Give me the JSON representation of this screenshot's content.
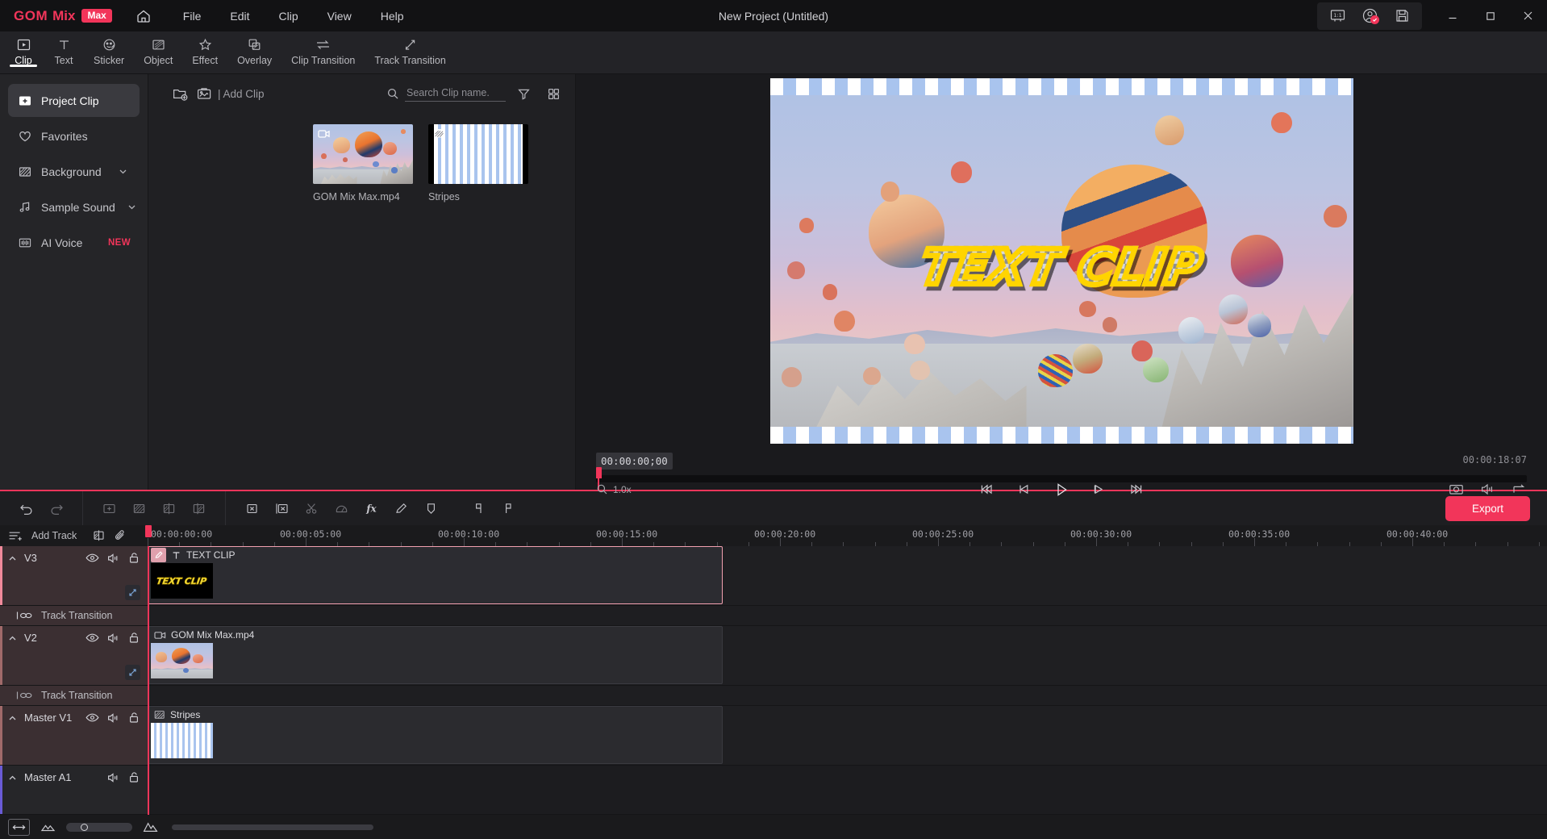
{
  "titlebar": {
    "brand_gom": "GOM",
    "brand_mix": "Mix",
    "brand_max": "Max",
    "home_icon": "home-icon",
    "menus": [
      "File",
      "Edit",
      "Clip",
      "View",
      "Help"
    ],
    "project_title": "New Project (Untitled)",
    "right_icons": [
      "ratio-1-1-icon",
      "account-icon",
      "save-icon"
    ],
    "window_buttons": [
      "minimize",
      "maximize",
      "close"
    ]
  },
  "ribbon": {
    "items": [
      {
        "label": "Clip",
        "icon": "clip-icon",
        "active": true
      },
      {
        "label": "Text",
        "icon": "text-icon",
        "active": false
      },
      {
        "label": "Sticker",
        "icon": "sticker-icon",
        "active": false
      },
      {
        "label": "Object",
        "icon": "object-icon",
        "active": false
      },
      {
        "label": "Effect",
        "icon": "effect-star-icon",
        "active": false
      },
      {
        "label": "Overlay",
        "icon": "overlay-icon",
        "active": false
      },
      {
        "label": "Clip Transition",
        "icon": "clip-transition-icon",
        "active": false
      },
      {
        "label": "Track Transition",
        "icon": "track-transition-icon",
        "active": false
      }
    ]
  },
  "sidebar": {
    "items": [
      {
        "label": "Project Clip",
        "icon": "folder-plus-icon",
        "active": true,
        "chevron": false,
        "badge": ""
      },
      {
        "label": "Favorites",
        "icon": "heart-icon",
        "active": false,
        "chevron": false,
        "badge": ""
      },
      {
        "label": "Background",
        "icon": "hatched-square-icon",
        "active": false,
        "chevron": true,
        "badge": ""
      },
      {
        "label": "Sample Sound",
        "icon": "music-note-icon",
        "active": false,
        "chevron": true,
        "badge": ""
      },
      {
        "label": "AI Voice",
        "icon": "waveform-icon",
        "active": false,
        "chevron": false,
        "badge": "NEW"
      }
    ]
  },
  "browser": {
    "toolbar": {
      "new_folder_icon": "folder-add-icon",
      "import_icon": "import-media-icon",
      "add_clip_label": "| Add Clip",
      "search_icon": "search-icon",
      "search_placeholder": "Search Clip name.",
      "search_value": "",
      "filter_icon": "filter-icon",
      "grid_icon": "grid-view-icon"
    },
    "clips": [
      {
        "name": "GOM Mix Max.mp4",
        "type": "video",
        "badge_icon": "video-camera-icon"
      },
      {
        "name": "Stripes",
        "type": "background",
        "badge_icon": "hatched-square-icon"
      }
    ]
  },
  "preview": {
    "overlay_text": "TEXT CLIP",
    "current_time": "00:00:00;00",
    "total_time": "00:00:18:07",
    "zoom_icon": "magnifier-icon",
    "zoom_level": "1.0x",
    "transport": [
      {
        "name": "skip-to-start-button",
        "icon": "skip-start-icon"
      },
      {
        "name": "step-back-button",
        "icon": "prev-frame-icon"
      },
      {
        "name": "play-button",
        "icon": "play-icon"
      },
      {
        "name": "step-forward-button",
        "icon": "next-frame-icon"
      },
      {
        "name": "skip-to-end-button",
        "icon": "skip-end-icon"
      }
    ],
    "right_icons": [
      "snapshot-camera-icon",
      "volume-icon",
      "export-frame-icon"
    ]
  },
  "timeline": {
    "toolbar": {
      "undo_icon": "undo-icon",
      "redo_icon": "redo-icon",
      "group_a": [
        "add-clip-icon",
        "background-clip-icon",
        "insert-left-icon",
        "insert-right-icon"
      ],
      "group_b": [
        "delete-clip-icon",
        "delete-ripple-icon",
        "split-scissors-icon",
        "speed-icon",
        "fx-icon",
        "pen-icon",
        "shield-icon",
        "marker-in-icon",
        "marker-out-icon"
      ],
      "export_label": "Export"
    },
    "ruler": {
      "add_track_label": "Add Track",
      "add_track_icon": "add-track-icon",
      "track_icons": [
        "insert-track-icon",
        "attach-icon"
      ],
      "labels": [
        "00:00:00:00",
        "00:00:05:00",
        "00:00:10:00",
        "00:00:15:00",
        "00:00:20:00",
        "00:00:25:00",
        "00:00:30:00",
        "00:00:35:00",
        "00:00:40:00"
      ]
    },
    "tracks": [
      {
        "name": "V3",
        "kind": "video",
        "accent": "#f08a9b",
        "controls": [
          "eye-icon",
          "speaker-icon",
          "lock-icon"
        ],
        "keyframe_icon": "keyframe-icon",
        "clip": {
          "title": "TEXT CLIP",
          "type_icon": "text-T-icon",
          "has_pen": true,
          "selected": true,
          "thumb": "text-clip-thumb"
        }
      },
      {
        "name": "V2",
        "kind": "video",
        "accent": "#a06a6a",
        "controls": [
          "eye-icon",
          "speaker-icon",
          "lock-icon"
        ],
        "keyframe_icon": "keyframe-icon",
        "clip": {
          "title": "GOM Mix Max.mp4",
          "type_icon": "video-camera-icon",
          "has_pen": false,
          "selected": false,
          "thumb": "balloon-thumb"
        }
      },
      {
        "name": "Master V1",
        "kind": "video",
        "accent": "#a06a6a",
        "controls": [
          "eye-icon",
          "speaker-icon",
          "lock-icon"
        ],
        "keyframe_icon": "",
        "clip": {
          "title": "Stripes",
          "type_icon": "hatched-square-icon",
          "has_pen": false,
          "selected": false,
          "thumb": "stripes-thumb"
        }
      },
      {
        "name": "Master A1",
        "kind": "audio",
        "accent": "#6a5bd6",
        "controls": [
          "speaker-icon",
          "lock-icon"
        ],
        "keyframe_icon": "",
        "clip": null
      }
    ],
    "track_transition_label": "Track Transition",
    "track_transition_icon": "link-icon"
  },
  "statusbar": {
    "fit_icon": "fit-to-window-icon",
    "zoom_out_icon": "zoom-out-mountain-icon",
    "zoom_in_icon": "zoom-in-mountain-icon",
    "zoom_value": "25"
  },
  "colors": {
    "accent": "#f2355a",
    "panel": "#202023",
    "titlebar": "#121214",
    "ribbon": "#232327",
    "video_track": "#3b2f32",
    "audio_accent": "#6a5bd6"
  }
}
